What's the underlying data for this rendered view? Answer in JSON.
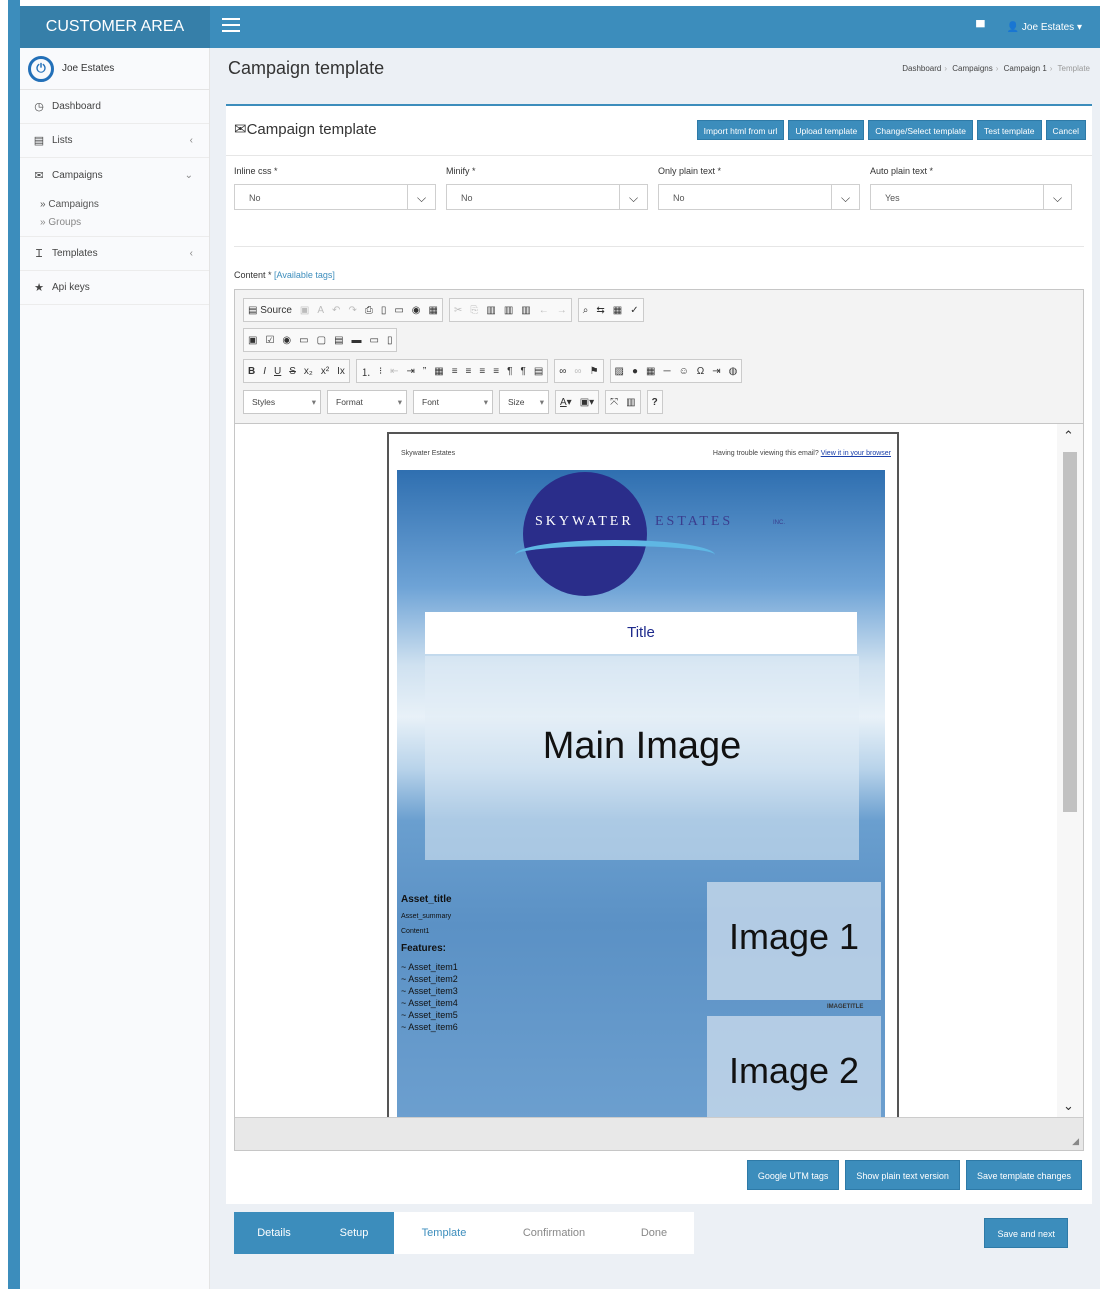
{
  "brand": "CUSTOMER AREA",
  "user": {
    "name": "Joe Estates",
    "menu_label": "Joe Estates"
  },
  "sidebar": {
    "items": [
      {
        "label": "Dashboard",
        "icon": "dashboard-icon"
      },
      {
        "label": "Lists",
        "icon": "list-icon"
      },
      {
        "label": "Campaigns",
        "icon": "envelope-icon"
      },
      {
        "label": "Templates",
        "icon": "text-cursor-icon"
      },
      {
        "label": "Api keys",
        "icon": "star-icon"
      }
    ],
    "campaigns_sub": [
      "Campaigns",
      "Groups"
    ]
  },
  "page": {
    "title": "Campaign template"
  },
  "breadcrumb": [
    "Dashboard",
    "Campaigns",
    "Campaign 1",
    "Template"
  ],
  "box": {
    "title": "Campaign template",
    "buttons": [
      "Import html from url",
      "Upload template",
      "Change/Select template",
      "Test template",
      "Cancel"
    ]
  },
  "fields": [
    {
      "label": "Inline css *",
      "value": "No"
    },
    {
      "label": "Minify *",
      "value": "No"
    },
    {
      "label": "Only plain text *",
      "value": "No"
    },
    {
      "label": "Auto plain text *",
      "value": "Yes"
    }
  ],
  "content_label": "Content *",
  "available_tags": "[Available tags]",
  "toolbar": {
    "source": "Source",
    "styles": "Styles",
    "format": "Format",
    "font": "Font",
    "size": "Size"
  },
  "email": {
    "sender": "Skywater Estates",
    "trouble": "Having trouble viewing this email?",
    "view_link": "View it in your browser",
    "logo_word1": "SKYWATER",
    "logo_word2": "ESTATES",
    "logo_inc": "INC.",
    "title": "Title",
    "main_image": "Main Image",
    "asset_title": "Asset_title",
    "asset_summary": "Asset_summary",
    "content1": "Content1",
    "features": "Features:",
    "items": [
      "~ Asset_item1",
      "~ Asset_item2",
      "~ Asset_item3",
      "~ Asset_item4",
      "~ Asset_item5",
      "~ Asset_item6"
    ],
    "image1": "Image 1",
    "image_title": "IMAGETITLE",
    "image2": "Image 2"
  },
  "footer_buttons": [
    "Google UTM tags",
    "Show plain text version",
    "Save template changes"
  ],
  "wizard": [
    "Details",
    "Setup",
    "Template",
    "Confirmation",
    "Done"
  ],
  "save_next": "Save and next",
  "colors": {
    "primary": "#3c8dbc",
    "brand_dark": "#367fa9"
  }
}
